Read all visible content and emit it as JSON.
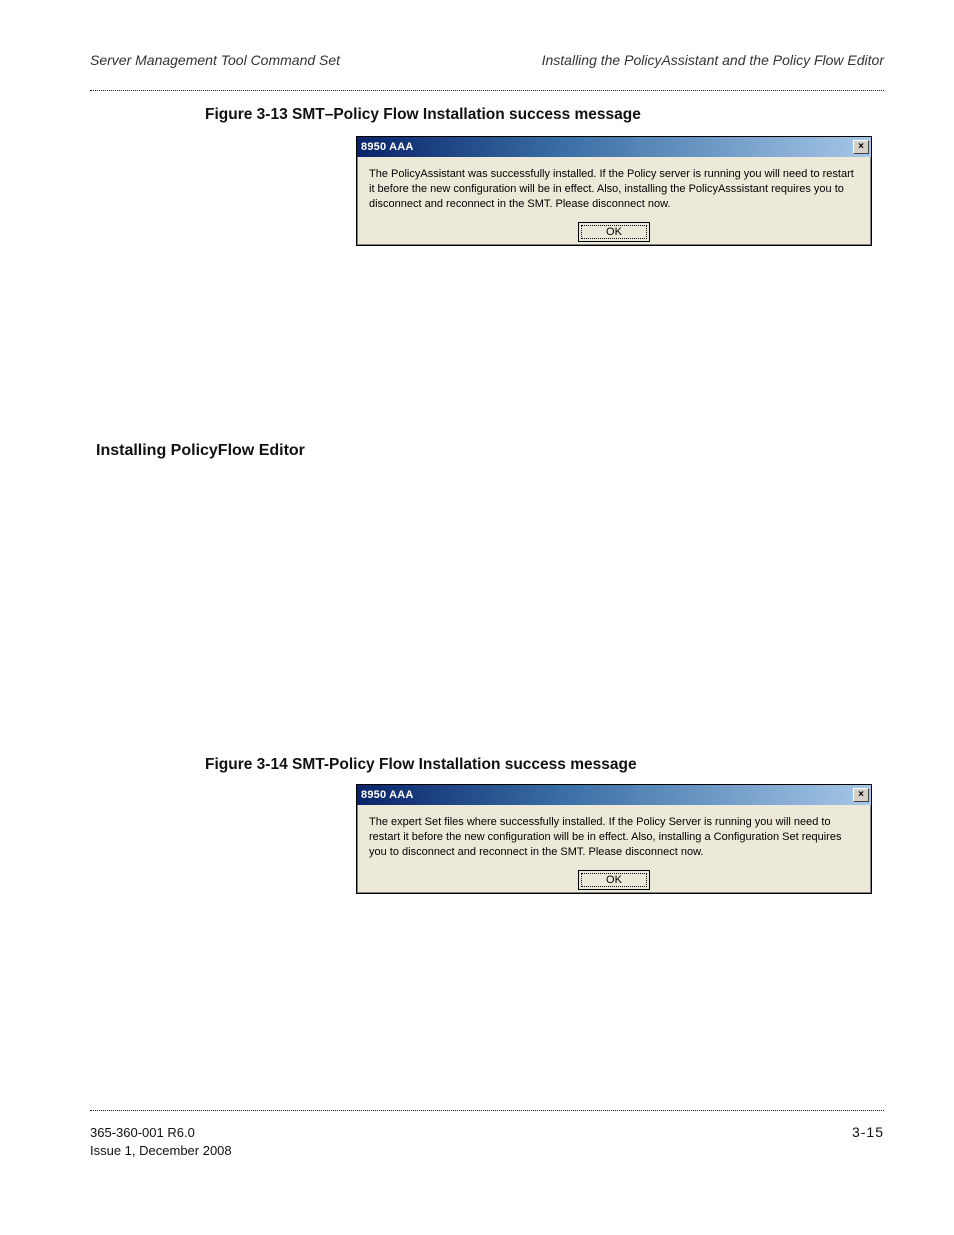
{
  "header": {
    "left": "Server Management Tool Command Set",
    "right": "Installing the PolicyAssistant and the Policy Flow Editor"
  },
  "figures": {
    "fig1": {
      "caption": "Figure 3-13   SMT–Policy Flow Installation success message",
      "dialog": {
        "title": "8950 AAA",
        "close": "×",
        "message": "The PolicyAssistant was successfully installed. If the Policy server is running you will need to restart it before the new configuration will be in effect. Also, installing the PolicyAsssistant requires you to disconnect and reconnect in the SMT. Please disconnect now.",
        "ok": "OK"
      }
    },
    "fig2": {
      "caption": "Figure 3-14   SMT-Policy Flow Installation success message",
      "dialog": {
        "title": "8950 AAA",
        "close": "×",
        "message": "The expert Set files where successfully installed. If the Policy Server is running you will need to restart it before the new configuration will be in effect. Also, installing a Configuration Set requires you to disconnect and reconnect in the SMT. Please disconnect now.",
        "ok": "OK"
      }
    }
  },
  "section_heading": "Installing PolicyFlow Editor",
  "footer": {
    "doc_id": "365-360-001 R6.0",
    "issue": "Issue 1,   December 2008",
    "page": "3-15"
  }
}
